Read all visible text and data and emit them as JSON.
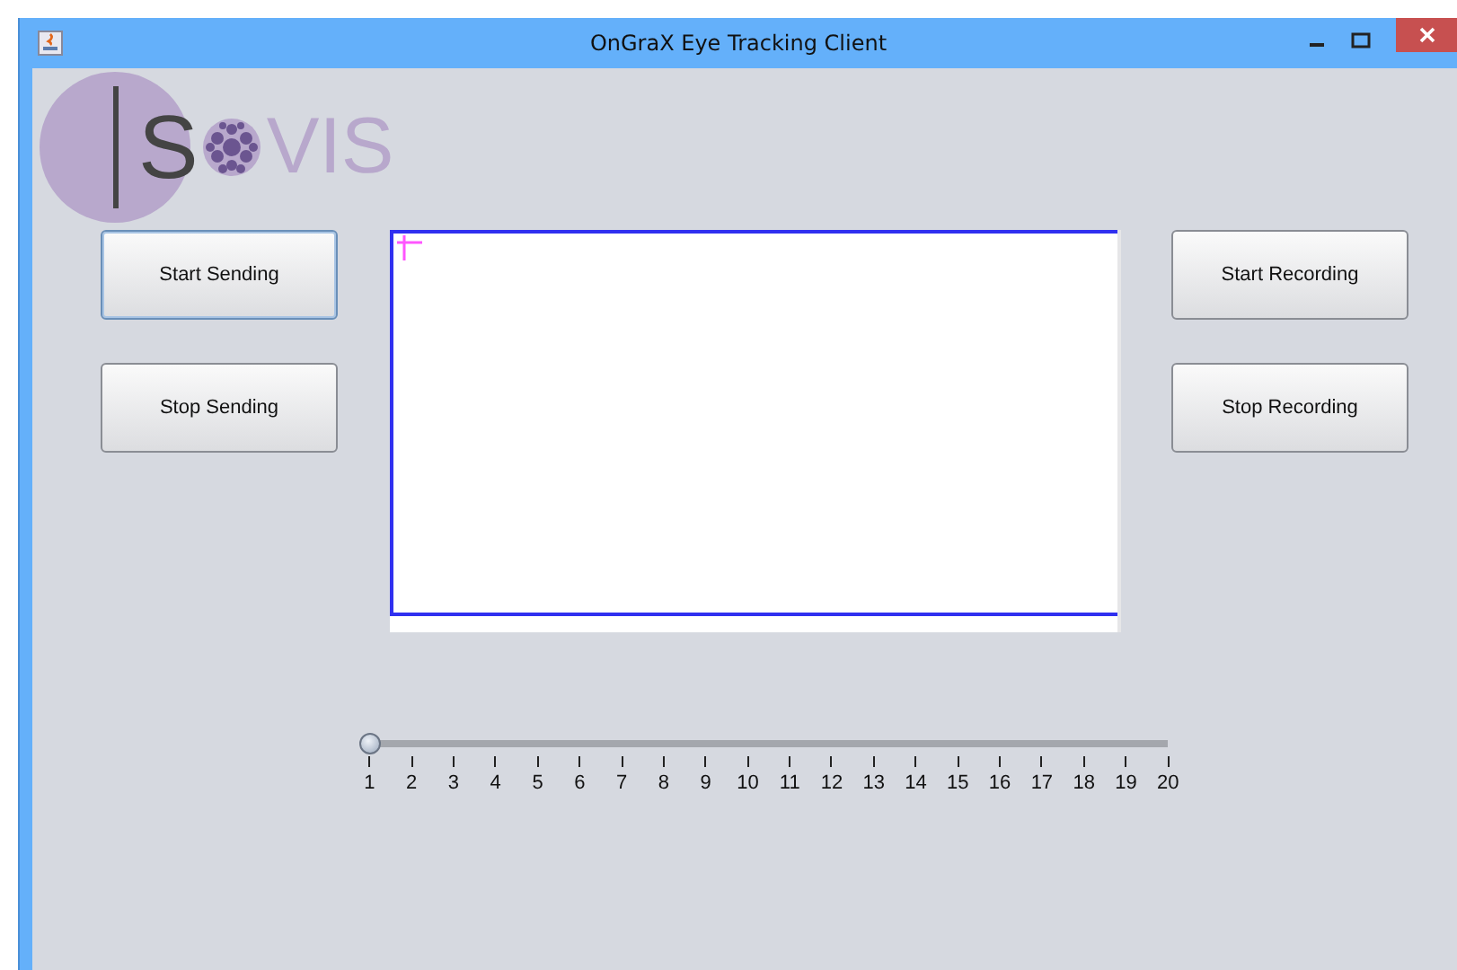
{
  "window": {
    "title": "OnGraX Eye Tracking Client"
  },
  "logo": {
    "letter": "S",
    "word": "VIS"
  },
  "left_buttons": [
    {
      "label": "Start Sending",
      "focused": true
    },
    {
      "label": "Stop Sending",
      "focused": false
    }
  ],
  "right_buttons": [
    {
      "label": "Start Recording",
      "focused": false
    },
    {
      "label": "Stop Recording",
      "focused": false
    }
  ],
  "slider": {
    "level": 0,
    "ticks": [
      "1",
      "2",
      "3",
      "4",
      "5",
      "6",
      "7",
      "8",
      "9",
      "10",
      "11",
      "12",
      "13",
      "14",
      "15",
      "16",
      "17",
      "18",
      "19",
      "20"
    ]
  }
}
